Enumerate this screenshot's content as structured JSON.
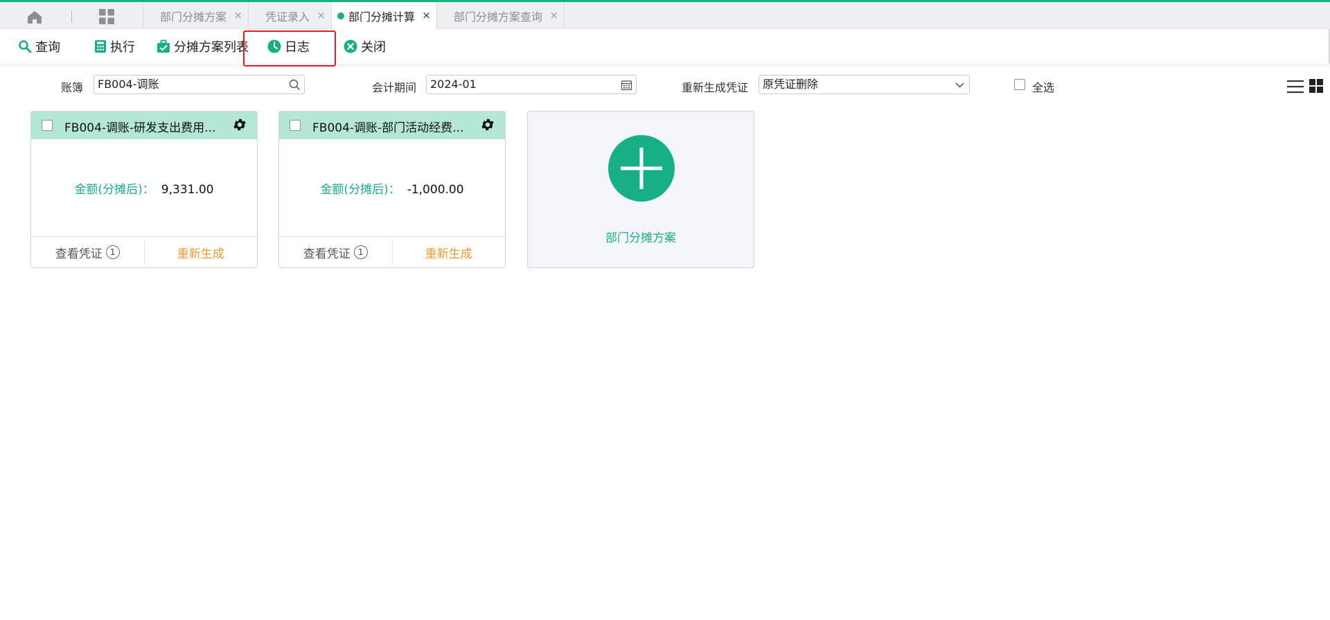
{
  "colors": {
    "accent": "#17b085",
    "highlight": "#e51c23",
    "regenerate": "#ef9a2f",
    "card_header": "#b4e8d4"
  },
  "tabbar": {
    "tabs": [
      {
        "label": "部门分摊方案",
        "active": false,
        "close": "×"
      },
      {
        "label": "凭证录入",
        "active": false,
        "close": "×"
      },
      {
        "label": "部门分摊计算",
        "active": true,
        "close": "×"
      },
      {
        "label": "部门分摊方案查询",
        "active": false,
        "close": "×"
      }
    ]
  },
  "toolbar": {
    "query": {
      "label": "查询",
      "icon": "search-icon"
    },
    "execute": {
      "label": "执行",
      "icon": "calculator-icon"
    },
    "scheme_list": {
      "label": "分摊方案列表",
      "icon": "briefcase-icon"
    },
    "log": {
      "label": "日志",
      "icon": "clock-icon"
    },
    "close": {
      "label": "关闭",
      "icon": "close-circle-icon"
    }
  },
  "filters": {
    "ledger_label": "账簿",
    "ledger_value": "FB004-调账",
    "period_label": "会计期间",
    "period_value": "2024-01",
    "regen_label": "重新生成凭证",
    "regen_value": "原凭证删除",
    "select_all_label": "全选"
  },
  "cards": [
    {
      "title": "FB004-调账-研发支出费用...",
      "amount_label": "金额(分摊后)：",
      "amount_value": "9,331.00",
      "view_label": "查看凭证",
      "view_count": "1",
      "regen_label": "重新生成"
    },
    {
      "title": "FB004-调账-部门活动经费...",
      "amount_label": "金额(分摊后)：",
      "amount_value": "-1,000.00",
      "view_label": "查看凭证",
      "view_count": "1",
      "regen_label": "重新生成"
    }
  ],
  "add_card": {
    "label": "部门分摊方案",
    "icon": "plus-circle-icon"
  }
}
